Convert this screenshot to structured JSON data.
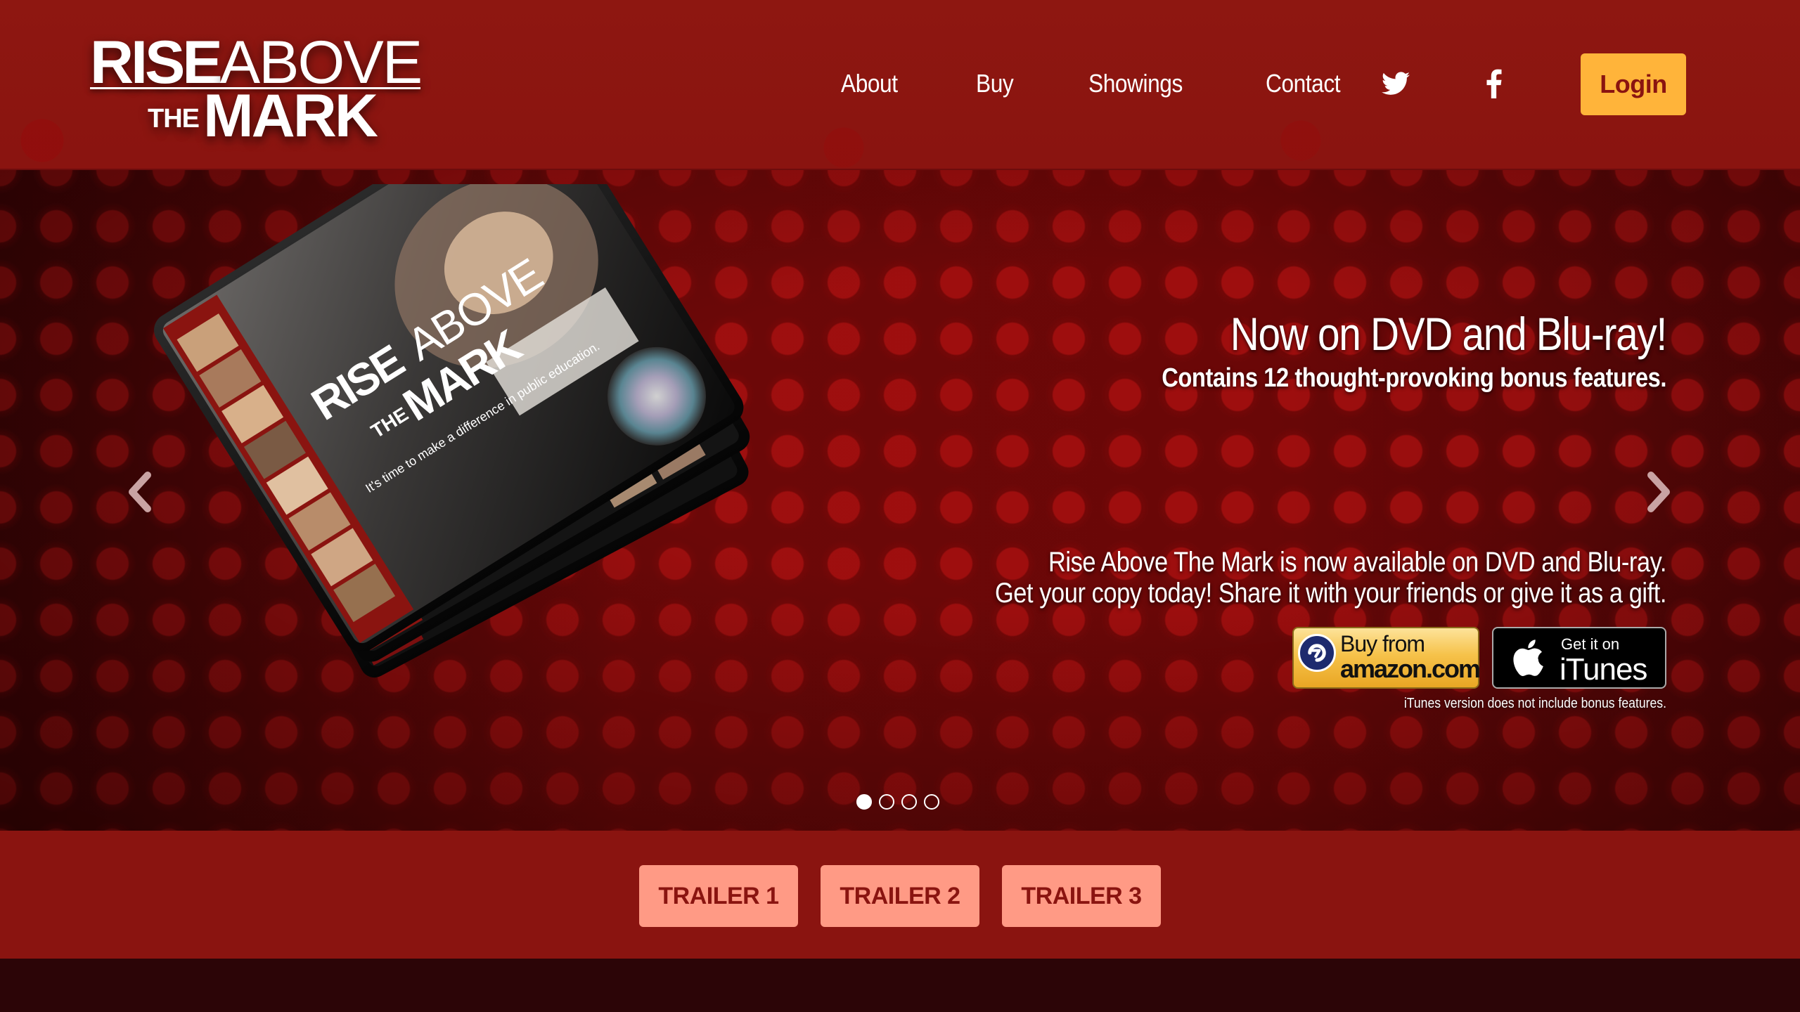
{
  "brand": {
    "logo_word_rise": "RISE",
    "logo_word_above": "ABOVE",
    "logo_word_the": "THE",
    "logo_word_mark": "MARK"
  },
  "nav": {
    "items": [
      "About",
      "Buy",
      "Showings",
      "Contact"
    ],
    "social": [
      "twitter-icon",
      "facebook-icon"
    ],
    "login_label": "Login"
  },
  "colors": {
    "header_bg": "#8a1410",
    "login_bg": "#ffb43a",
    "trailer_btn_bg": "#ff9a85",
    "trailer_btn_text": "#8a1410"
  },
  "hero": {
    "title": "Now on DVD and Blu-ray!",
    "subtitle": "Contains 12 thought-provoking bonus features.",
    "body_line1": "Rise Above The Mark is now available on DVD and Blu-ray.",
    "body_line2": "Get your copy today! Share it with your friends or give it as a gift.",
    "amazon_line1": "Buy from",
    "amazon_line2": "amazon.com",
    "itunes_line1": "Get it on",
    "itunes_line2": "iTunes",
    "itunes_note": "iTunes version does not include bonus features.",
    "dvd_cover_tagline": "It's time to make a difference in public education.",
    "slides_total": 4,
    "slide_active": 1
  },
  "trailers": {
    "buttons": [
      "TRAILER 1",
      "TRAILER 2",
      "TRAILER 3"
    ]
  }
}
